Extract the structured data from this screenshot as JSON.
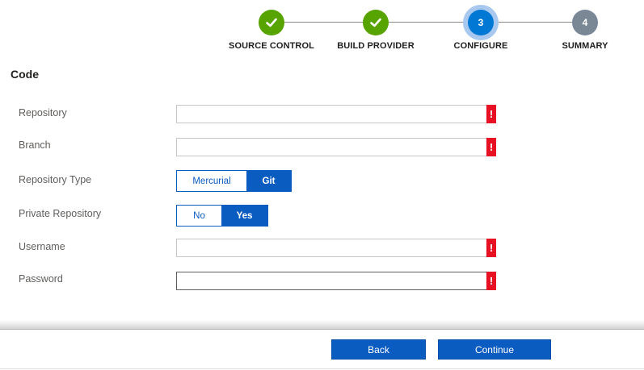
{
  "stepper": {
    "steps": [
      {
        "label": "SOURCE CONTROL",
        "state": "done"
      },
      {
        "label": "BUILD PROVIDER",
        "state": "done"
      },
      {
        "label": "CONFIGURE",
        "number": "3",
        "state": "current"
      },
      {
        "label": "SUMMARY",
        "number": "4",
        "state": "todo"
      }
    ]
  },
  "section": {
    "title": "Code"
  },
  "fields": {
    "repository": {
      "label": "Repository",
      "value": ""
    },
    "branch": {
      "label": "Branch",
      "value": ""
    },
    "repository_type": {
      "label": "Repository Type",
      "options": [
        "Mercurial",
        "Git"
      ],
      "selected": "Git"
    },
    "private_repository": {
      "label": "Private Repository",
      "options": [
        "No",
        "Yes"
      ],
      "selected": "Yes"
    },
    "username": {
      "label": "Username",
      "value": ""
    },
    "password": {
      "label": "Password",
      "value": ""
    },
    "error_mark": "!"
  },
  "footer": {
    "back_label": "Back",
    "continue_label": "Continue"
  },
  "colors": {
    "accent": "#0b5cc1",
    "done": "#57a300",
    "todo": "#7a8896",
    "error": "#e81123"
  }
}
